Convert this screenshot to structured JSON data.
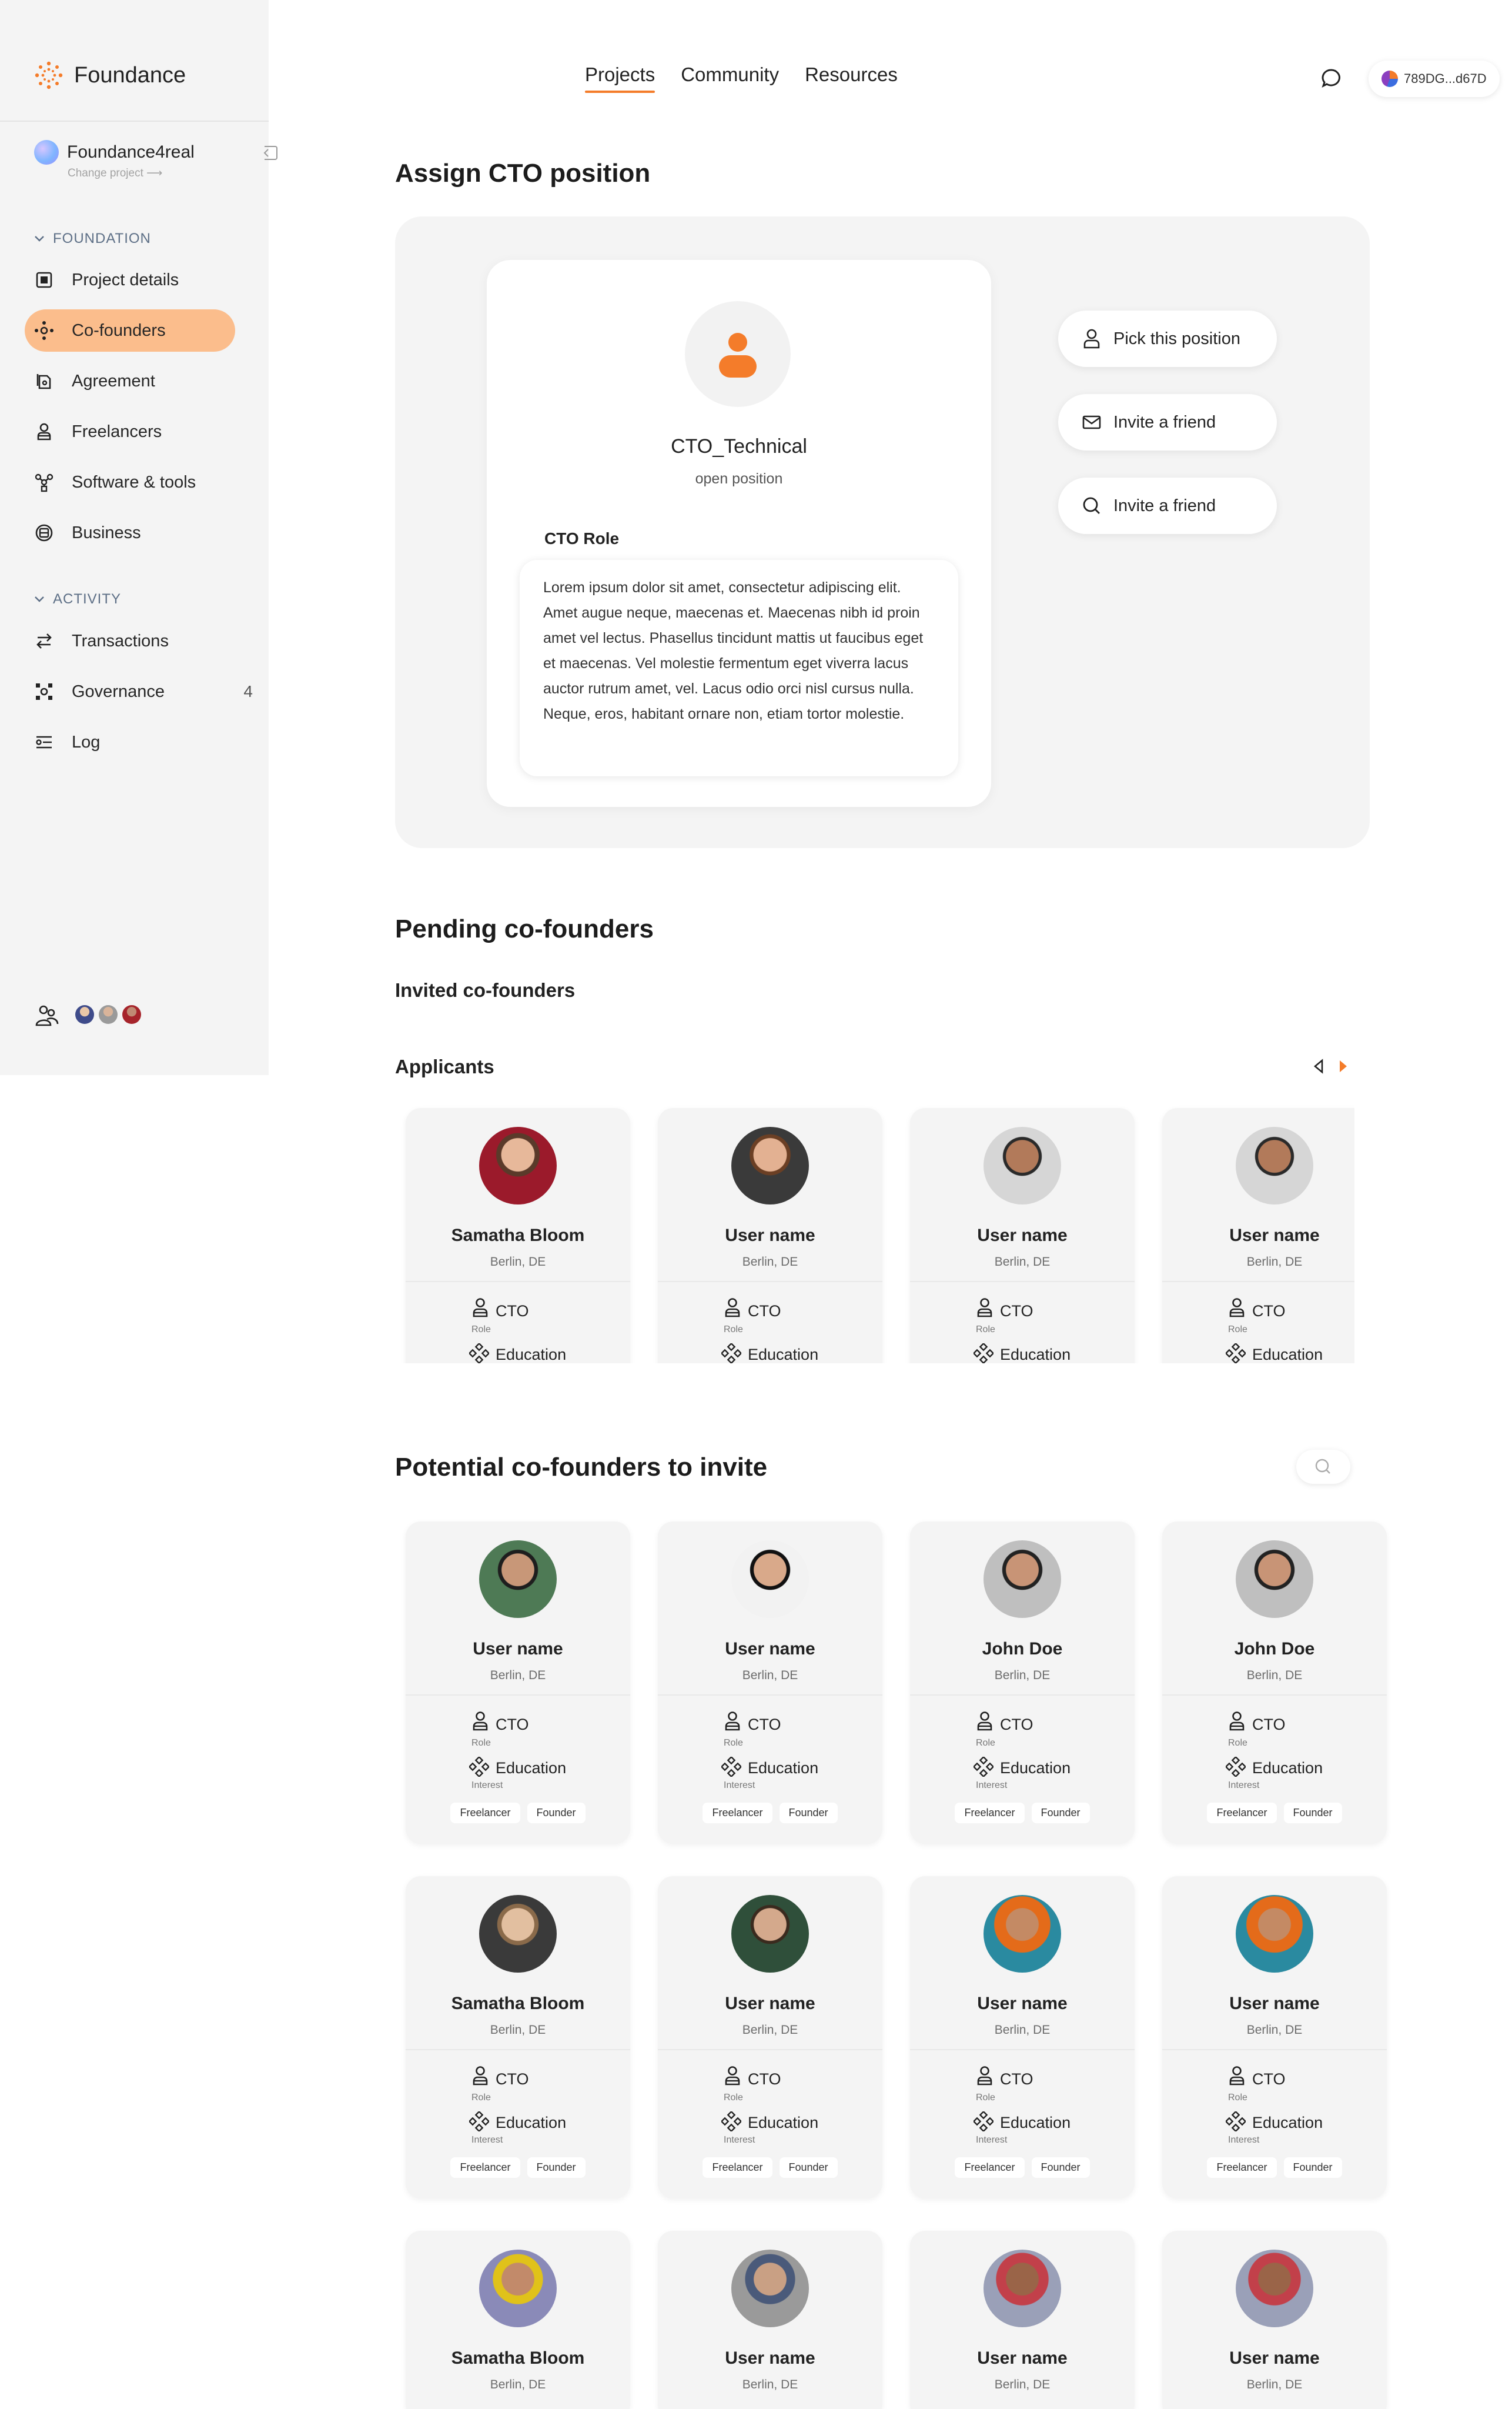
{
  "brand": {
    "name": "Foundance",
    "accent": "#f47c2a",
    "highlight": "#fbbd8c"
  },
  "project": {
    "name": "Foundance4real",
    "change_label": "Change project ⟶"
  },
  "sidebar": {
    "section_foundation": "FOUNDATION",
    "section_activity": "ACTIVITY",
    "foundation_items": [
      {
        "label": "Project details",
        "icon": "project-details-icon"
      },
      {
        "label": "Co-founders",
        "icon": "cofounders-icon",
        "active": true
      },
      {
        "label": "Agreement",
        "icon": "agreement-icon"
      },
      {
        "label": "Freelancers",
        "icon": "freelancers-icon"
      },
      {
        "label": "Software & tools",
        "icon": "software-icon"
      },
      {
        "label": "Business",
        "icon": "business-icon"
      }
    ],
    "activity_items": [
      {
        "label": "Transactions",
        "icon": "transactions-icon"
      },
      {
        "label": "Governance",
        "icon": "governance-icon",
        "count": "4"
      },
      {
        "label": "Log",
        "icon": "log-icon"
      }
    ]
  },
  "topnav": {
    "items": [
      "Projects",
      "Community",
      "Resources"
    ],
    "active": "Projects"
  },
  "wallet": {
    "address": "789DG...d67D"
  },
  "assign": {
    "heading": "Assign CTO position",
    "position_title": "CTO_Technical",
    "position_status": "open position",
    "role_label": "CTO Role",
    "role_text": "Lorem ipsum dolor sit amet, consectetur adipiscing elit. Amet augue neque, maecenas et. Maecenas nibh id proin amet vel lectus. Phasellus tincidunt mattis ut faucibus eget et maecenas. Vel molestie fermentum eget viverra lacus auctor rutrum amet, vel. Lacus odio orci nisl cursus nulla. Neque, eros, habitant ornare non, etiam tortor molestie.",
    "actions": [
      "Pick this position",
      "Invite a friend",
      "Invite a friend"
    ]
  },
  "pending": {
    "heading": "Pending co-founders",
    "invited_heading": "Invited co-founders",
    "applicants_heading": "Applicants",
    "applicants": [
      {
        "name": "Samatha Bloom",
        "location": "Berlin, DE",
        "role": "CTO",
        "role_caption": "Role",
        "interest": "Education"
      },
      {
        "name": "User name",
        "location": "Berlin, DE",
        "role": "CTO",
        "role_caption": "Role",
        "interest": "Education"
      },
      {
        "name": "User name",
        "location": "Berlin, DE",
        "role": "CTO",
        "role_caption": "Role",
        "interest": "Education"
      },
      {
        "name": "User name",
        "location": "Berlin, DE",
        "role": "CTO",
        "role_caption": "Role",
        "interest": "Education"
      }
    ]
  },
  "potential": {
    "heading": "Potential co-founders to invite",
    "people": [
      {
        "name": "User name",
        "location": "Berlin, DE",
        "role": "CTO",
        "role_caption": "Role",
        "interest": "Education",
        "interest_caption": "Interest",
        "tags": [
          "Freelancer",
          "Founder"
        ]
      },
      {
        "name": "User name",
        "location": "Berlin, DE",
        "role": "CTO",
        "role_caption": "Role",
        "interest": "Education",
        "interest_caption": "Interest",
        "tags": [
          "Freelancer",
          "Founder"
        ]
      },
      {
        "name": "John Doe",
        "location": "Berlin, DE",
        "role": "CTO",
        "role_caption": "Role",
        "interest": "Education",
        "interest_caption": "Interest",
        "tags": [
          "Freelancer",
          "Founder"
        ]
      },
      {
        "name": "John Doe",
        "location": "Berlin, DE",
        "role": "CTO",
        "role_caption": "Role",
        "interest": "Education",
        "interest_caption": "Interest",
        "tags": [
          "Freelancer",
          "Founder"
        ]
      },
      {
        "name": "Samatha Bloom",
        "location": "Berlin, DE",
        "role": "CTO",
        "role_caption": "Role",
        "interest": "Education",
        "interest_caption": "Interest",
        "tags": [
          "Freelancer",
          "Founder"
        ]
      },
      {
        "name": "User name",
        "location": "Berlin, DE",
        "role": "CTO",
        "role_caption": "Role",
        "interest": "Education",
        "interest_caption": "Interest",
        "tags": [
          "Freelancer",
          "Founder"
        ]
      },
      {
        "name": "User name",
        "location": "Berlin, DE",
        "role": "CTO",
        "role_caption": "Role",
        "interest": "Education",
        "interest_caption": "Interest",
        "tags": [
          "Freelancer",
          "Founder"
        ]
      },
      {
        "name": "User name",
        "location": "Berlin, DE",
        "role": "CTO",
        "role_caption": "Role",
        "interest": "Education",
        "interest_caption": "Interest",
        "tags": [
          "Freelancer",
          "Founder"
        ]
      },
      {
        "name": "Samatha Bloom",
        "location": "Berlin, DE"
      },
      {
        "name": "User name",
        "location": "Berlin, DE"
      },
      {
        "name": "User name",
        "location": "Berlin, DE"
      },
      {
        "name": "User name",
        "location": "Berlin, DE"
      }
    ]
  }
}
